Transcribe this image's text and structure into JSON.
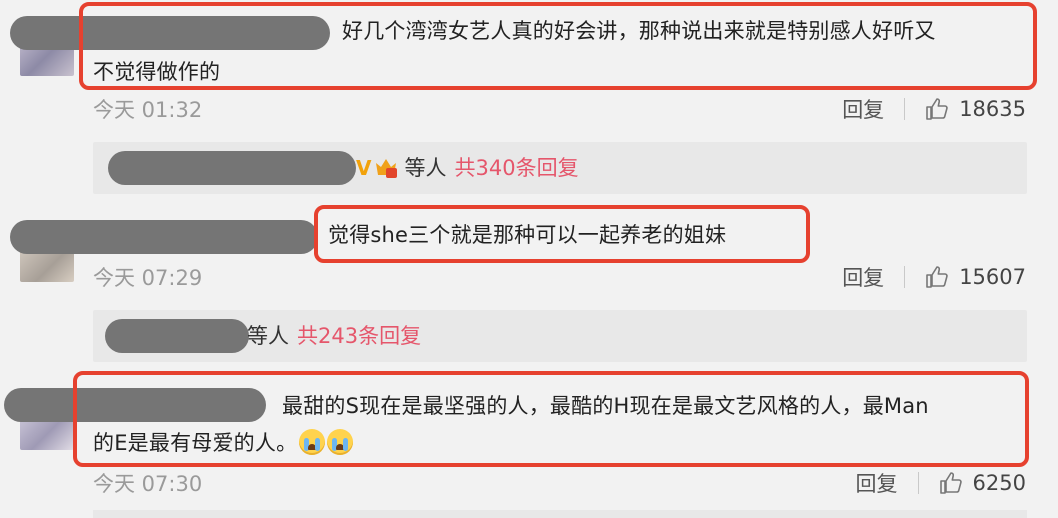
{
  "comments": [
    {
      "text_line1": "好几个湾湾女艺人真的好会讲，那种说出来就是特别感人好听又",
      "text_line2": "不觉得做作的",
      "time": "今天 01:32",
      "reply_label": "回复",
      "likes": "18635",
      "replies": {
        "who_suffix": "等人",
        "count_text": "共340条回复"
      }
    },
    {
      "text_line1": "觉得she三个就是那种可以一起养老的姐妹",
      "time": "今天 07:29",
      "reply_label": "回复",
      "likes": "15607",
      "replies": {
        "who_suffix": "等人",
        "count_text": "共243条回复"
      }
    },
    {
      "text_line1": "最甜的S现在是最坚强的人，最酷的H现在是最文艺风格的人，最Man",
      "text_line2": "的E是最有母爱的人。",
      "emojis": [
        "crying-emoji",
        "crying-emoji"
      ],
      "time": "今天 07:30",
      "reply_label": "回复",
      "likes": "6250"
    }
  ],
  "colors": {
    "highlight": "#e6412f",
    "reply_count": "#e5566b",
    "background": "#f2f2f2",
    "redaction": "#757575"
  }
}
